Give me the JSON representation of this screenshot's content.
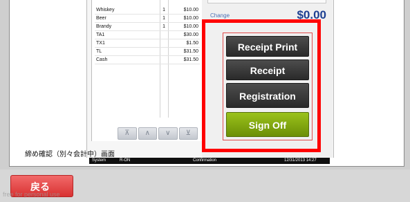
{
  "receipt": {
    "items": [
      {
        "name": "Whiskey",
        "qty": "1",
        "amount": "$10.00"
      },
      {
        "name": "Beer",
        "qty": "1",
        "amount": "$10.00"
      },
      {
        "name": "Brandy",
        "qty": "1",
        "amount": "$10.00"
      },
      {
        "name": "TA1",
        "qty": "",
        "amount": "$30.00"
      },
      {
        "name": "TX1",
        "qty": "",
        "amount": "$1.50"
      },
      {
        "name": "TL",
        "qty": "",
        "amount": "$31.50"
      },
      {
        "name": "Cash",
        "qty": "",
        "amount": "$31.50"
      }
    ]
  },
  "total": {
    "label": "Change",
    "amount": "$0.00"
  },
  "actions": {
    "receipt_print": "Receipt Print",
    "receipt": "Receipt",
    "registration": "Registration",
    "sign_off": "Sign Off"
  },
  "caption": "締め確認（別々会計中）画面",
  "status_bar": {
    "mode": "System",
    "operator": "R-ON",
    "screen": "Confirmation",
    "datetime": "12/31/2013 14:27"
  },
  "back_button": "戻る",
  "watermark": "free for personal use",
  "nav_icons": [
    "double-up-icon",
    "up-icon",
    "down-icon",
    "double-down-icon"
  ],
  "colors": {
    "highlight": "#ff0000",
    "sign_off": "#8cb514",
    "back": "#e04444"
  }
}
